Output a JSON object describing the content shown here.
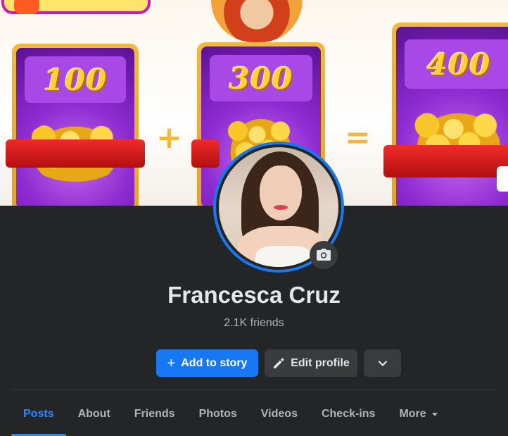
{
  "cover": {
    "cards": [
      {
        "value": "100"
      },
      {
        "value": "300"
      },
      {
        "value": "400"
      }
    ],
    "operators": [
      "+",
      "="
    ]
  },
  "profile": {
    "name": "Francesca Cruz",
    "friends": "2.1K friends"
  },
  "actions": {
    "add_story_label": "Add to story",
    "edit_profile_label": "Edit profile"
  },
  "tabs": [
    {
      "label": "Posts",
      "active": true
    },
    {
      "label": "About"
    },
    {
      "label": "Friends"
    },
    {
      "label": "Photos"
    },
    {
      "label": "Videos"
    },
    {
      "label": "Check-ins"
    },
    {
      "label": "More",
      "dropdown": true
    }
  ],
  "colors": {
    "background": "#242526",
    "primary": "#1877f2",
    "tab_active": "#2d88ff",
    "text": "#e4e6eb",
    "muted": "#b0b3b8"
  },
  "icons": {
    "add": "plus-icon",
    "edit": "pencil-icon",
    "more": "chevron-down-icon",
    "camera": "camera-icon",
    "dropdown": "caret-down-icon"
  }
}
